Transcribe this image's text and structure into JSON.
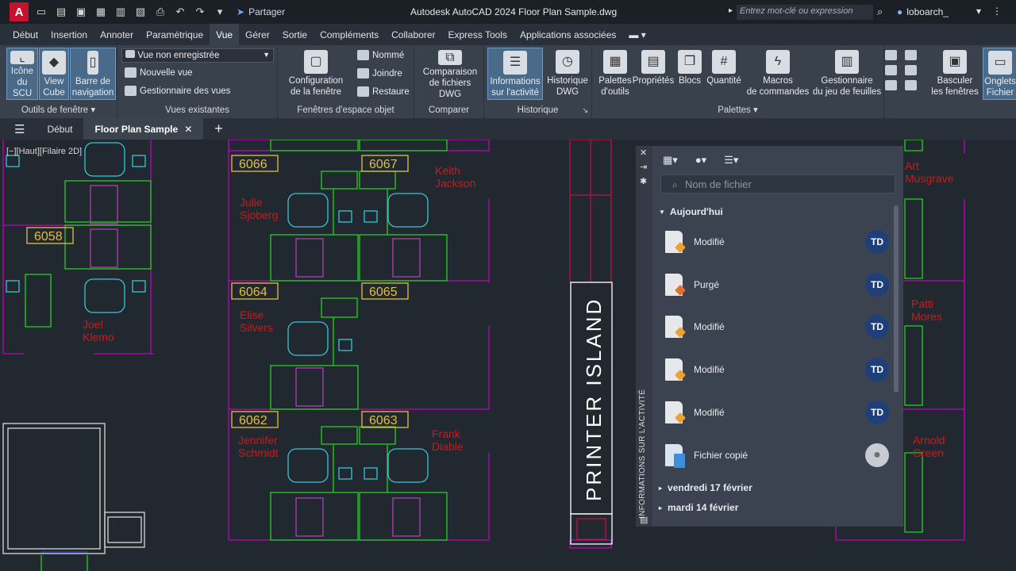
{
  "titlebar": {
    "app_logo": "A",
    "share_label": "Partager",
    "title": "Autodesk AutoCAD 2024   Floor Plan Sample.dwg",
    "search_placeholder": "Entrez mot-clé ou expression",
    "user": "loboarch_",
    "icons": [
      "new-icon",
      "open-icon",
      "save-icon",
      "saveas-icon",
      "cloud-open-icon",
      "cloud-save-icon",
      "plot-icon",
      "undo-icon",
      "redo-icon"
    ]
  },
  "menu": {
    "tabs": [
      "Début",
      "Insertion",
      "Annoter",
      "Paramétrique",
      "Vue",
      "Gérer",
      "Sortie",
      "Compléments",
      "Collaborer",
      "Express Tools",
      "Applications associées"
    ],
    "active": "Vue"
  },
  "ribbon": {
    "outils": {
      "title": "Outils de fenêtre",
      "scu": "Icône\ndu SCU",
      "viewcube": "View\nCube",
      "nav": "Barre de\nnavigation"
    },
    "vues": {
      "title": "Vues existantes",
      "dropdown": "Vue non enregistrée",
      "nouvelle": "Nouvelle vue",
      "gestionnaire": "Gestionnaire des vues"
    },
    "fenetres": {
      "title": "Fenêtres d'espace objet",
      "config": "Configuration\nde la fenêtre",
      "nomme": "Nommé",
      "joindre": "Joindre",
      "restaure": "Restaure"
    },
    "comparer": {
      "title": "Comparer",
      "comparaison": "Comparaison\nde fichiers DWG"
    },
    "historique": {
      "title": "Historique",
      "informations": "Informations\nsur l'activité",
      "historique_dwg": "Historique\nDWG"
    },
    "palettes": {
      "title": "Palettes",
      "outils": "Palettes\nd'outils",
      "proprietes": "Propriétés",
      "blocs": "Blocs",
      "quantite": "Quantité",
      "macros": "Macros\nde commandes",
      "gestionnaire": "Gestionnaire\ndu jeu de feuilles"
    },
    "interface": {
      "basculer": "Basculer\nles fenêtres",
      "onglets": "Onglets\nFichier"
    }
  },
  "doctabs": {
    "debut": "Début",
    "active": "Floor Plan Sample"
  },
  "viewport": {
    "label": "[−][Haut][Filaire 2D]"
  },
  "drawing": {
    "rooms": [
      "6066",
      "6067",
      "6058",
      "6064",
      "6065",
      "6062",
      "6063"
    ],
    "names": [
      {
        "first": "Julie",
        "last": "Sjoberg"
      },
      {
        "first": "Keith",
        "last": "Jackson"
      },
      {
        "first": "Joel",
        "last": "Klemo"
      },
      {
        "first": "Elise",
        "last": "Silvers"
      },
      {
        "first": "Jennifer",
        "last": "Schmidt"
      },
      {
        "first": "Frank",
        "last": "Diable"
      },
      {
        "first": "Art",
        "last": "Musgrave"
      },
      {
        "first": "Patti",
        "last": "Mores"
      },
      {
        "first": "Arnold",
        "last": "Green"
      }
    ],
    "printer_island": "PRINTER ISLAND",
    "colors": {
      "walls": "#c000c0",
      "furniture": "#22d022",
      "chairs": "#33c8d8",
      "tags": "#e0c040",
      "names": "#d01818"
    }
  },
  "palette": {
    "vertical_title": "INFORMATIONS SUR L'ACTIVITÉ",
    "search_placeholder": "Nom de fichier",
    "today_header": "Aujourd'hui",
    "activities": [
      {
        "label": "Modifié",
        "kind": "modify",
        "avatar": "TD"
      },
      {
        "label": "Purgé",
        "kind": "purge",
        "avatar": "TD"
      },
      {
        "label": "Modifié",
        "kind": "modify",
        "avatar": "TD"
      },
      {
        "label": "Modifié",
        "kind": "modify",
        "avatar": "TD"
      },
      {
        "label": "Modifié",
        "kind": "modify",
        "avatar": "TD"
      },
      {
        "label": "Fichier copié",
        "kind": "copy",
        "avatar": ""
      }
    ],
    "dates": [
      "vendredi 17 février",
      "mardi 14 février"
    ]
  }
}
